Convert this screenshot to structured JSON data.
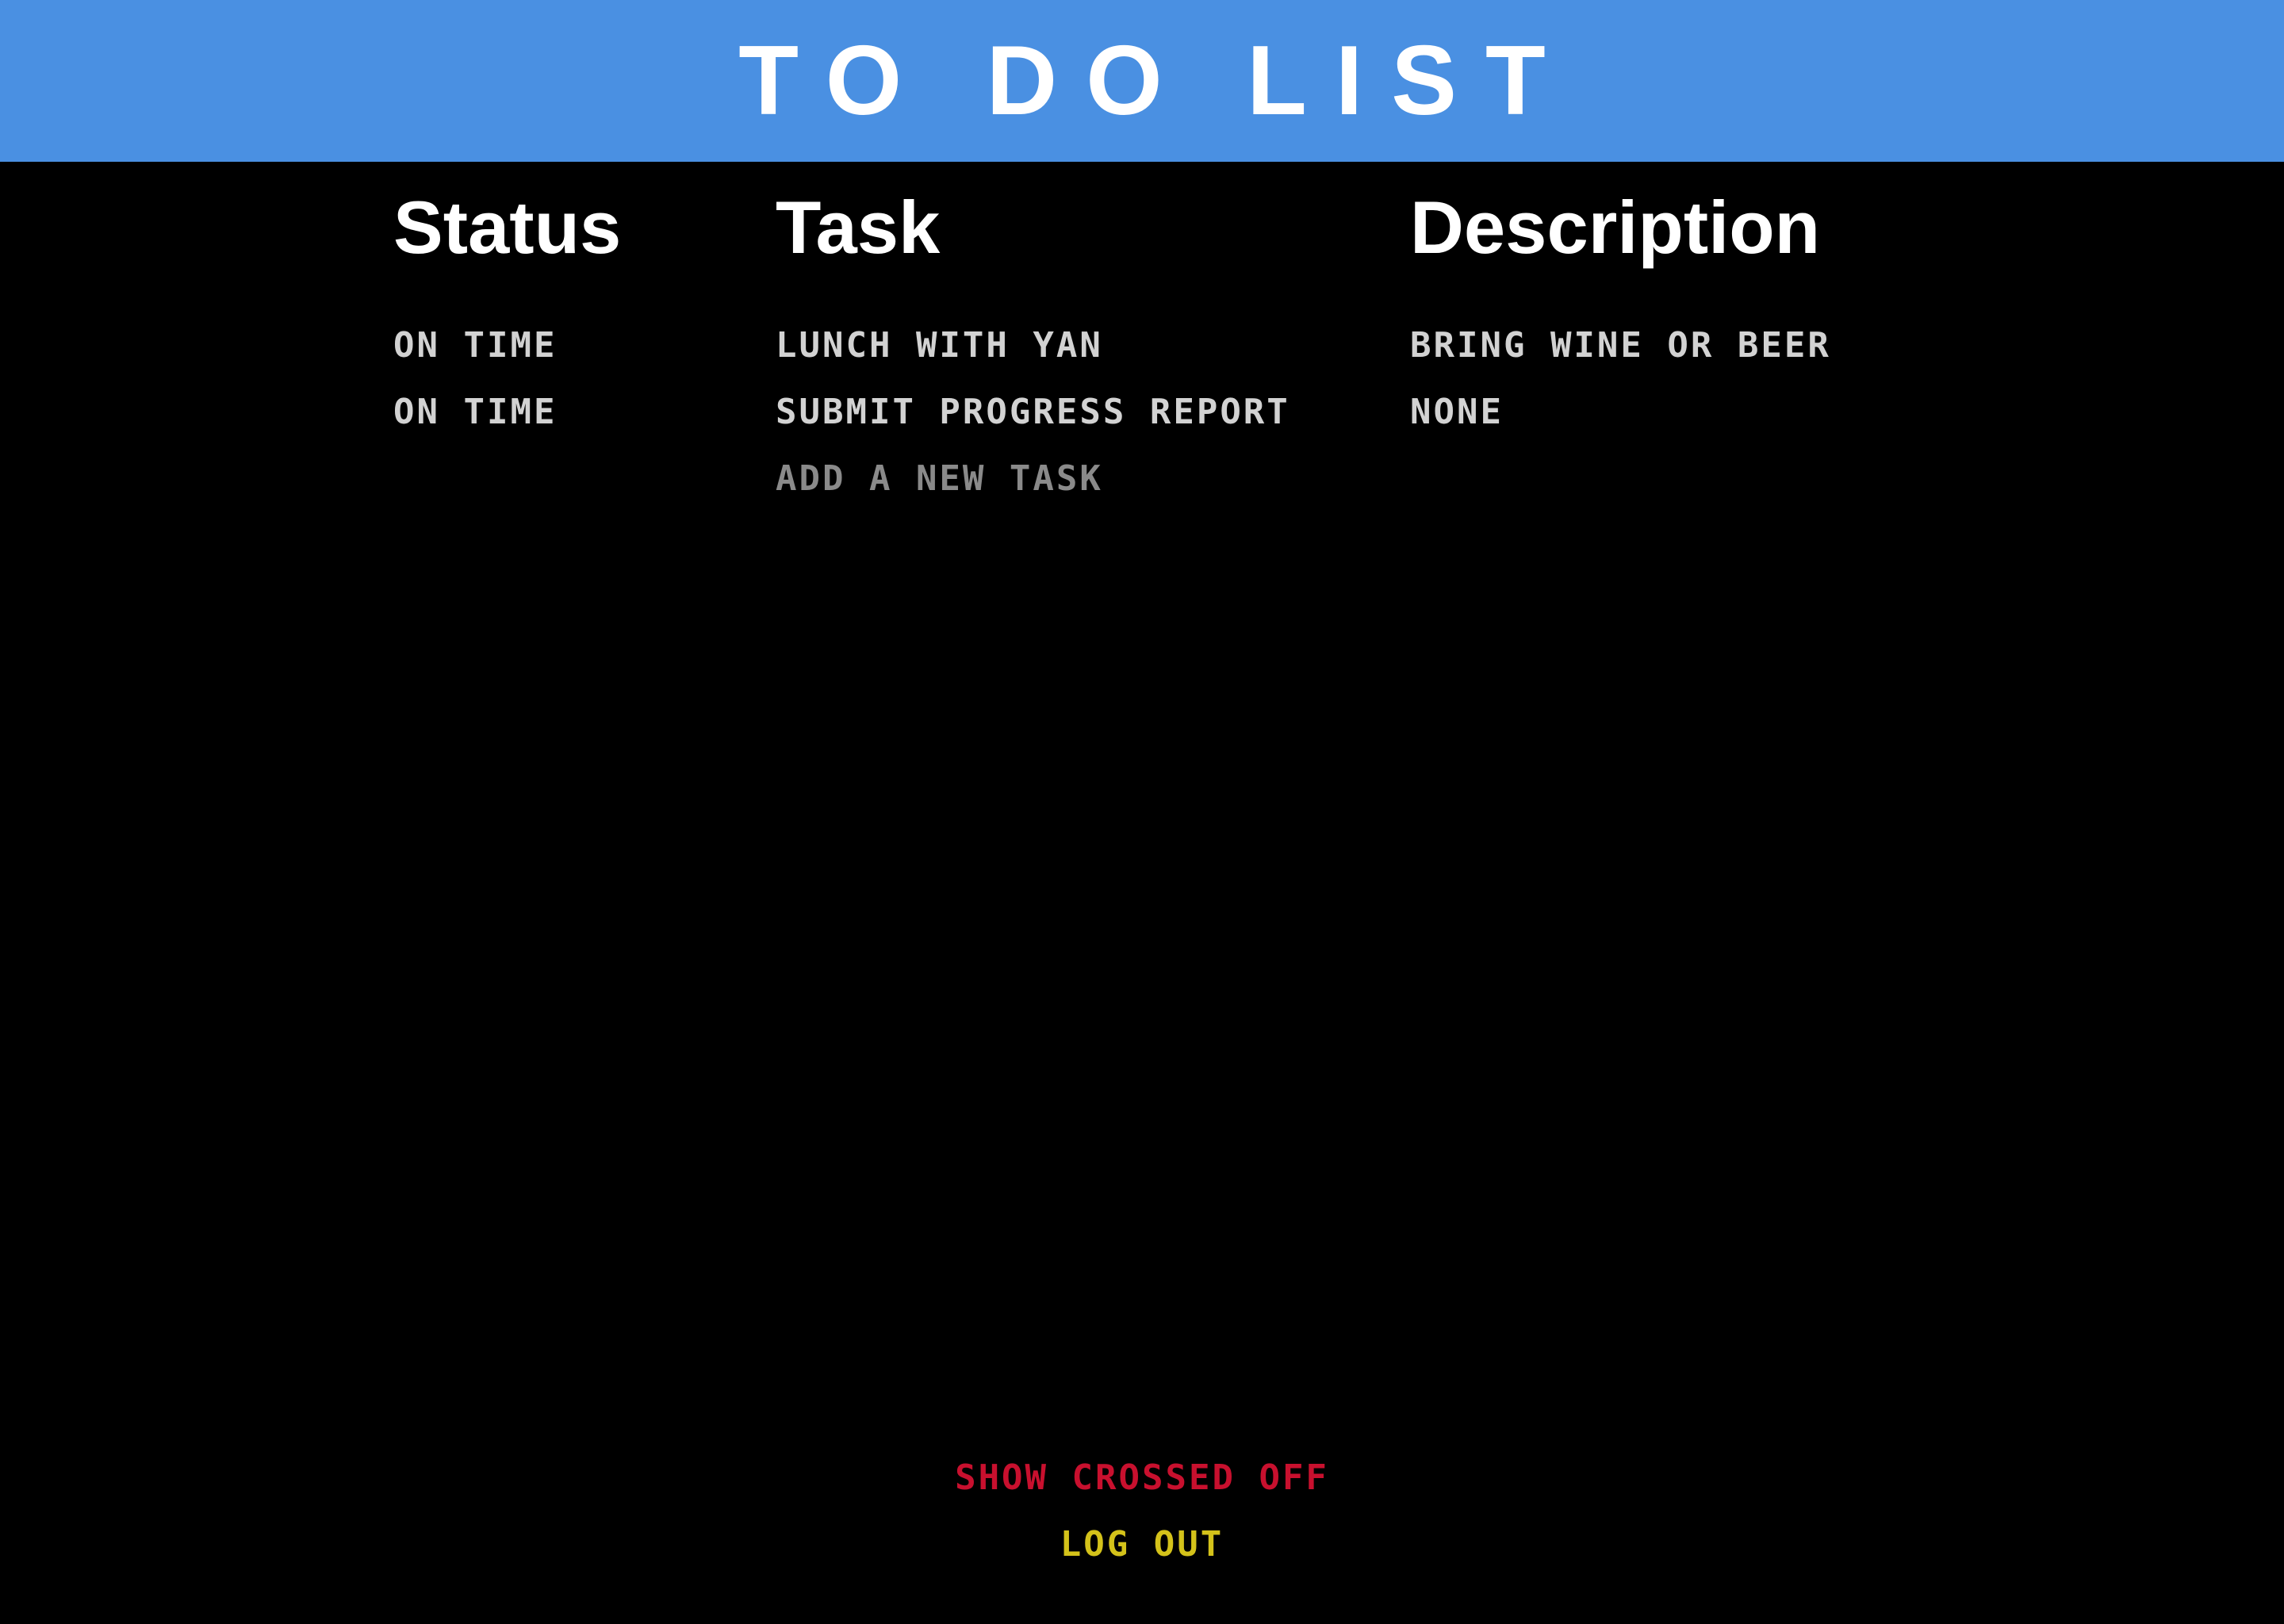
{
  "header": {
    "title": "TO DO LIST"
  },
  "columns": {
    "status": "Status",
    "task": "Task",
    "description": "Description"
  },
  "tasks": [
    {
      "status": "ON TIME",
      "task": "LUNCH WITH YAN",
      "description": "BRING WINE OR BEER"
    },
    {
      "status": "ON TIME",
      "task": "SUBMIT PROGRESS REPORT",
      "description": "NONE"
    }
  ],
  "add_task": {
    "placeholder": "ADD A NEW TASK"
  },
  "footer": {
    "show_crossed_off": "SHOW CROSSED OFF",
    "log_out": "LOG OUT"
  },
  "colors": {
    "header_bg": "#4a90e2",
    "background": "#000000",
    "show_crossed_off": "#c8102e",
    "log_out": "#d4c21a"
  }
}
